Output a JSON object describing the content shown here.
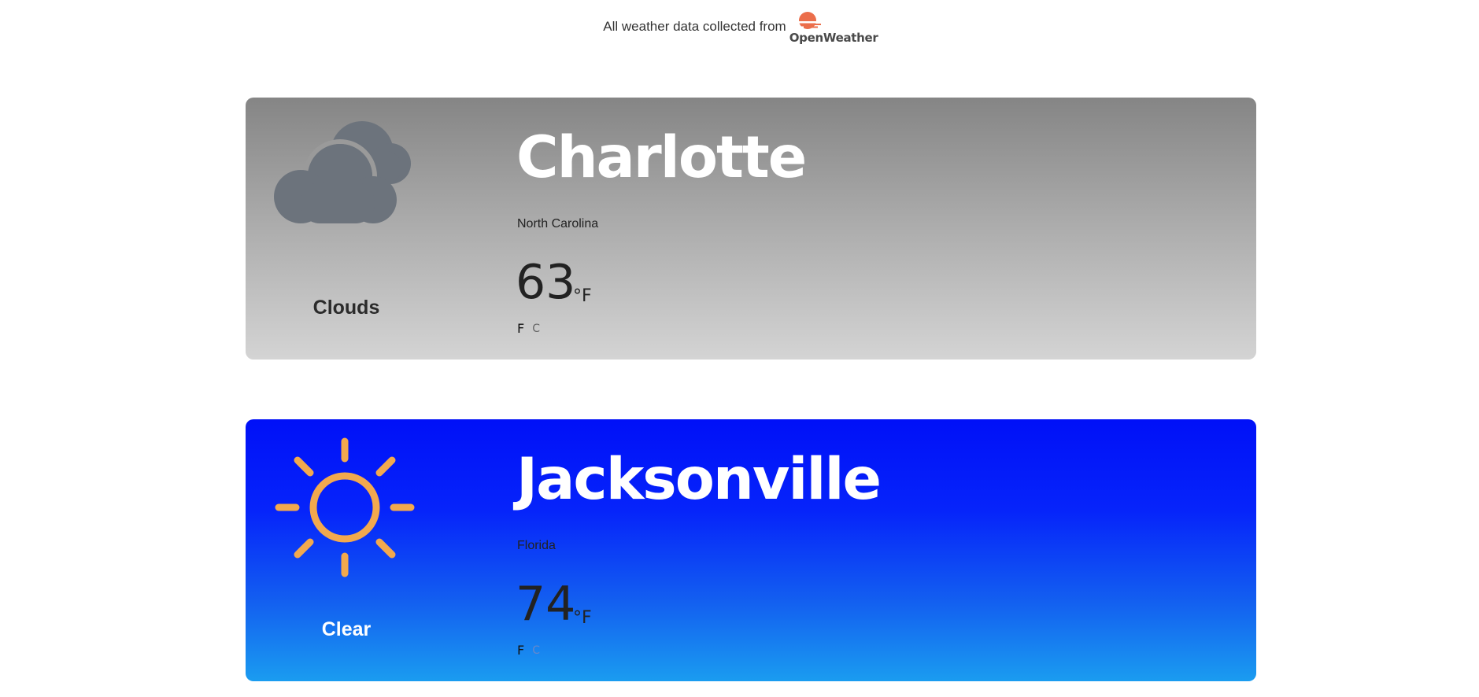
{
  "attribution": {
    "text": "All weather data collected from",
    "provider": "OpenWeather",
    "logo_color": "#eb6e4b"
  },
  "cards": [
    {
      "condition": "Clouds",
      "icon": "cloud-icon",
      "city": "Charlotte",
      "region": "North Carolina",
      "temperature": "63",
      "temp_unit": "°F",
      "unit_f_label": "F",
      "unit_c_label": "C",
      "colors": {
        "top": "#858585",
        "bottom": "#d4d4d4",
        "icon": "#6c737c"
      }
    },
    {
      "condition": "Clear",
      "icon": "sun-icon",
      "city": "Jacksonville",
      "region": "Florida",
      "temperature": "74",
      "temp_unit": "°F",
      "unit_f_label": "F",
      "unit_c_label": "C",
      "colors": {
        "top": "#0010f8",
        "bottom": "#1a9cf0",
        "icon": "#f2a94e"
      }
    }
  ]
}
